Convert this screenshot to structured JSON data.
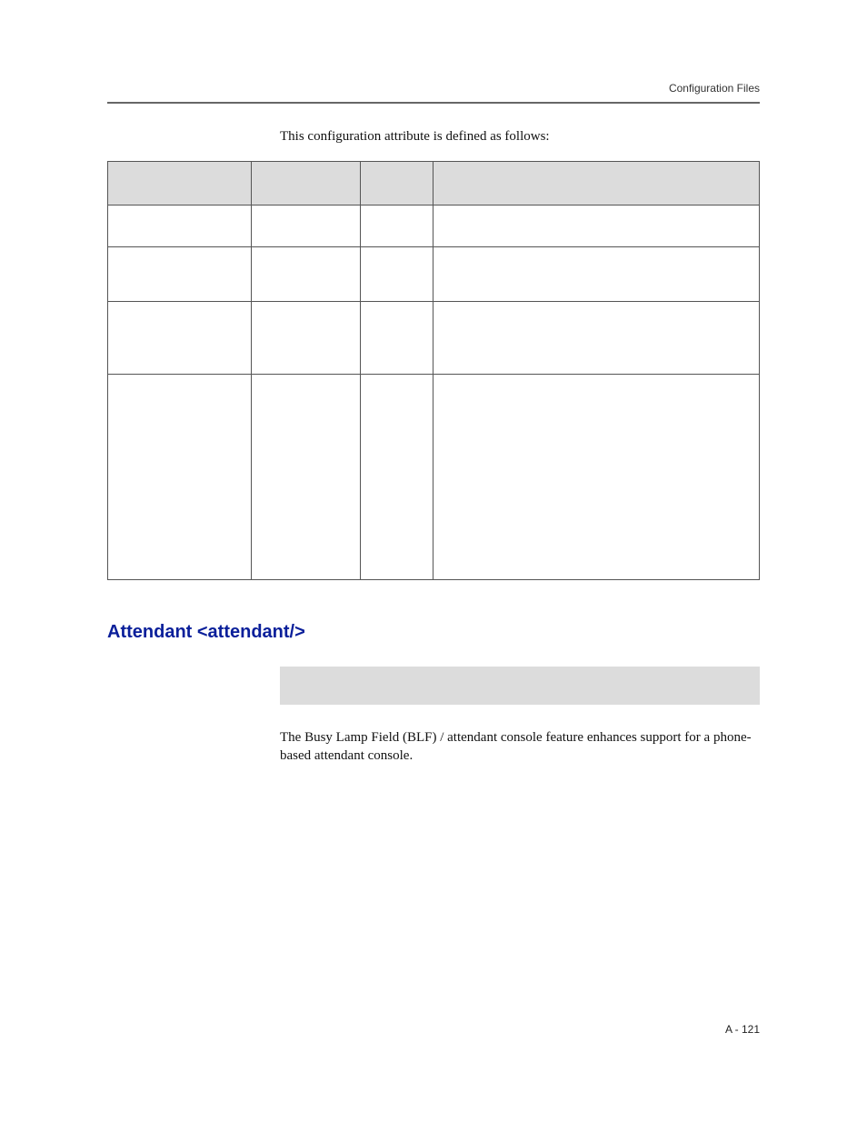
{
  "header": {
    "running": "Configuration Files"
  },
  "intro": "This configuration attribute is defined as follows:",
  "table": {
    "headers": [
      "",
      "",
      "",
      ""
    ],
    "rows": [
      [
        "",
        "",
        "",
        ""
      ],
      [
        "",
        "",
        "",
        ""
      ],
      [
        "",
        "",
        "",
        ""
      ],
      [
        "",
        "",
        "",
        ""
      ]
    ]
  },
  "section": {
    "heading": "Attendant <attendant/>"
  },
  "body": {
    "p1": "The Busy Lamp Field (BLF) / attendant console feature enhances support for a phone-based attendant console."
  },
  "footer": {
    "page": "A - 121"
  }
}
